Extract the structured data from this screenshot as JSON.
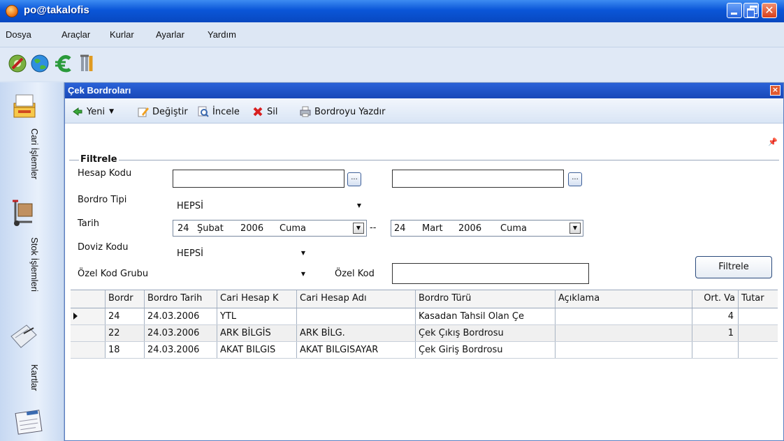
{
  "window": {
    "title": "po@takalofis"
  },
  "menu": [
    "Dosya",
    "Araçlar",
    "Kurlar",
    "Ayarlar",
    "Yardım"
  ],
  "app_toolbar_icons": [
    "tools-settings-icon",
    "globe-icon",
    "euro-icon",
    "wrench-icon"
  ],
  "nav": [
    {
      "label": "Cari İşlemler",
      "icon": "folder-stack-icon"
    },
    {
      "label": "Stok İşlemleri",
      "icon": "hand-truck-icon"
    },
    {
      "label": "Kartlar",
      "icon": "notebook-icon"
    },
    {
      "label": "",
      "icon": "accounts-ledger-icon"
    }
  ],
  "child": {
    "title": "Çek Bordroları",
    "close": "×",
    "toolbar": {
      "new": "Yeni",
      "edit": "Değiştir",
      "inspect": "İncele",
      "delete": "Sil",
      "print": "Bordroyu Yazdır"
    },
    "pin": "ꟷ"
  },
  "filter": {
    "legend": "Filtrele",
    "hesap_kodu_label": "Hesap Kodu",
    "hesap_kodu_from": "",
    "hesap_kodu_to": "",
    "browse": "...",
    "bordro_tipi_label": "Bordro Tipi",
    "bordro_tipi_value": "HEPSİ",
    "tarih_label": "Tarih",
    "date_from": {
      "day": "24",
      "month": "Şubat",
      "year": "2006",
      "weekday": "Cuma"
    },
    "date_sep": "--",
    "date_to": {
      "day": "24",
      "month": "Mart",
      "year": "2006",
      "weekday": "Cuma"
    },
    "doviz_label": "Doviz Kodu",
    "doviz_value": "HEPSİ",
    "ozel_grup_label": "Özel Kod Grubu",
    "ozel_grup_value": "",
    "ozel_kod_label": "Özel Kod",
    "ozel_kod_value": "",
    "button": "Filtrele"
  },
  "grid": {
    "columns": [
      "Bordr",
      "Bordro Tarih",
      "Cari Hesap K",
      "Cari Hesap Adı",
      "Bordro Türü",
      "Açıklama",
      "Ort. Va",
      "Tutar"
    ],
    "rows": [
      {
        "no": "24",
        "date": "24.03.2006",
        "code": "YTL",
        "name": "",
        "type": "Kasadan Tahsil Olan Çe",
        "desc": "",
        "ortva": "4",
        "tutar": ""
      },
      {
        "no": "22",
        "date": "24.03.2006",
        "code": "ARK BİLGİS",
        "name": "ARK BİLG.",
        "type": "Çek Çıkış Bordrosu",
        "desc": "",
        "ortva": "1",
        "tutar": ""
      },
      {
        "no": "18",
        "date": "24.03.2006",
        "code": "AKAT BILGIS",
        "name": "AKAT BILGISAYAR",
        "type": "Çek Giriş Bordrosu",
        "desc": "",
        "ortva": "",
        "tutar": ""
      }
    ],
    "selected_row": 0
  }
}
